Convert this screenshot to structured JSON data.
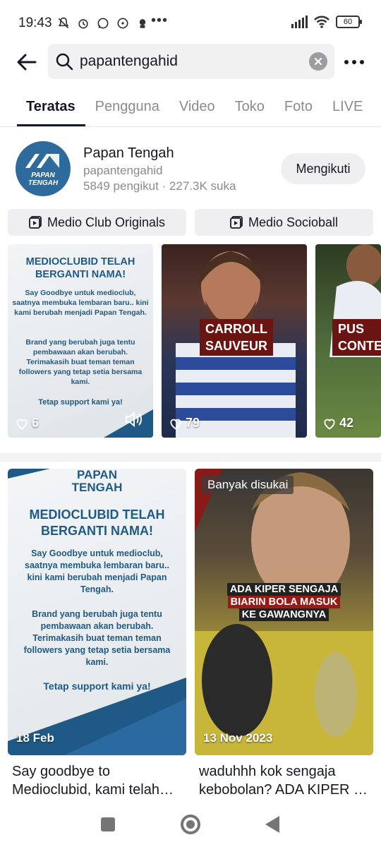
{
  "status_bar": {
    "time": "19:43",
    "battery": "60"
  },
  "search": {
    "query": "papantengahid"
  },
  "tabs": [
    {
      "label": "Teratas",
      "active": true
    },
    {
      "label": "Pengguna"
    },
    {
      "label": "Video"
    },
    {
      "label": "Toko"
    },
    {
      "label": "Foto"
    },
    {
      "label": "LIVE"
    }
  ],
  "user": {
    "name": "Papan Tengah",
    "handle": "papantengahid",
    "stats": "5849 pengikut · 227.3K suka",
    "follow_label": "Mengikuti",
    "avatar_text_1": "PAPAN",
    "avatar_text_2": "TENGAH"
  },
  "playlists": [
    {
      "label": "Medio Club Originals"
    },
    {
      "label": "Medio Socioball"
    }
  ],
  "thumbnails": [
    {
      "likes": "6",
      "heading": "MEDIOCLUBID TELAH BERGANTI NAMA!",
      "body_1": "Say Goodbye untuk medioclub, saatnya membuka lembaran baru.. kini kami berubah menjadi Papan Tengah.",
      "body_2": "Brand yang berubah juga tentu pembawaan akan berubah. Terimakasih buat teman teman followers yang tetap setia bersama kami.",
      "body_3": "Tetap support kami ya!"
    },
    {
      "likes": "79",
      "label_1": "CARROLL",
      "label_2": "SAUVEUR"
    },
    {
      "likes": "42",
      "label_1": "PUS",
      "label_2": "CONTE"
    }
  ],
  "cards": [
    {
      "date": "18 Feb",
      "logo_text_1": "PAPAN",
      "logo_text_2": "TENGAH",
      "heading": "MEDIOCLUBID TELAH BERGANTI NAMA!",
      "body_1": "Say Goodbye untuk medioclub, saatnya membuka lembaran baru.. kini kami berubah menjadi Papan Tengah.",
      "body_2": "Brand yang berubah juga tentu pembawaan akan berubah. Terimakasih buat teman teman followers yang tetap setia bersama kami.",
      "body_3": "Tetap support kami ya!",
      "caption": "Say goodbye to Medioclubid, kami telah…"
    },
    {
      "badge": "Banyak disukai",
      "date": "13 Nov 2023",
      "overlay_1": "ADA KIPER SENGAJA",
      "overlay_2": "BIARIN BOLA MASUK",
      "overlay_3": "KE GAWANGNYA",
      "caption": "waduhhh kok sengaja kebobolan? ADA KIPER …"
    }
  ]
}
